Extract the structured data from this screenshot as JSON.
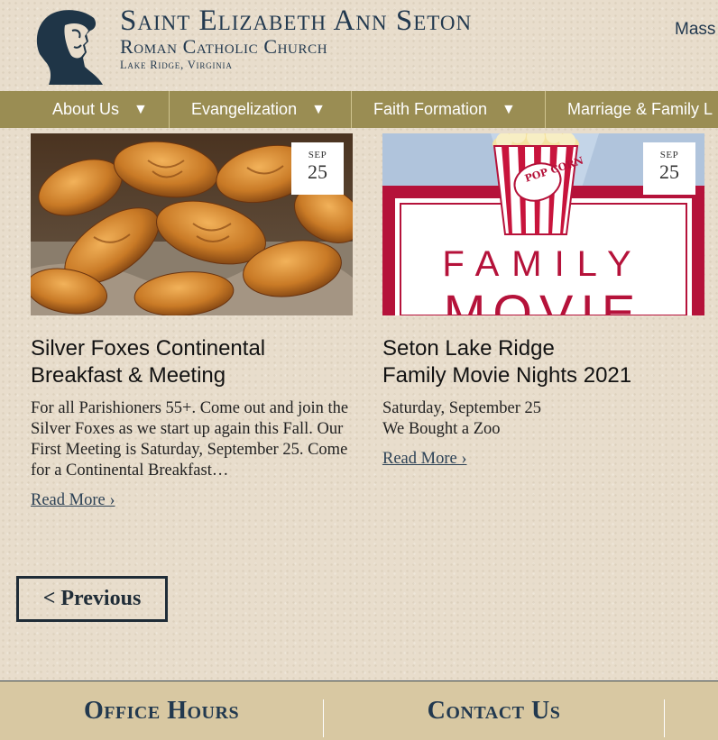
{
  "header": {
    "title": "Saint Elizabeth Ann Seton",
    "subtitle": "Roman Catholic Church",
    "location": "Lake Ridge, Virginia",
    "mass_link": "Mass"
  },
  "nav": [
    {
      "label": "About Us",
      "arrow": "▼"
    },
    {
      "label": "Evangelization",
      "arrow": "▼"
    },
    {
      "label": "Faith Formation",
      "arrow": "▼"
    },
    {
      "label": "Marriage & Family L",
      "arrow": ""
    }
  ],
  "events": [
    {
      "month": "SEP",
      "day": "25",
      "title_line1": "Silver Foxes Continental",
      "title_line2": "Breakfast & Meeting",
      "desc": "For all Parishioners 55+.  Come out and join the Silver Foxes as we start up again this Fall. Our First Meeting is Saturday, September 25. Come for a Continental Breakfast…",
      "read_more": "Read More ›"
    },
    {
      "month": "SEP",
      "day": "25",
      "title_line1": "Seton Lake Ridge",
      "title_line2": "Family Movie Nights 2021",
      "desc_line1": "Saturday, September 25",
      "desc_line2": "We Bought a Zoo",
      "read_more": "Read More ›",
      "poster_text": "FAMILY MOVIE",
      "popcorn_text": "POP CORN"
    }
  ],
  "pagination": {
    "previous": "< Previous"
  },
  "footer": {
    "office_hours": "Office Hours",
    "contact_us": "Contact Us"
  },
  "colors": {
    "nav_bg": "#9a8d53",
    "title": "#22394f",
    "footer_bg": "#d8c8a2",
    "poster_red": "#b5123a"
  }
}
